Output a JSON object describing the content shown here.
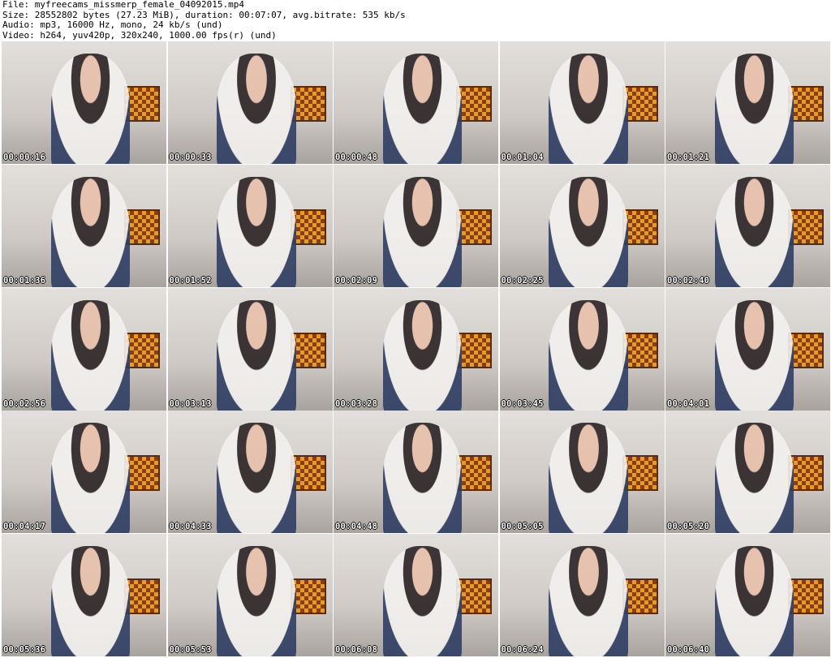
{
  "header": {
    "file_line": "File: myfreecams_missmerp_female_04092015.mp4",
    "size_line": "Size: 28552802 bytes (27.23 MiB), duration: 00:07:07, avg.bitrate: 535 kb/s",
    "audio_line": "Audio: mp3, 16000 Hz, mono, 24 kb/s (und)",
    "video_line": "Video: h264, yuv420p, 320x240, 1000.00 fps(r) (und)"
  },
  "thumbnails": [
    {
      "timestamp": "00:00:16"
    },
    {
      "timestamp": "00:00:33"
    },
    {
      "timestamp": "00:00:48"
    },
    {
      "timestamp": "00:01:04"
    },
    {
      "timestamp": "00:01:21"
    },
    {
      "timestamp": "00:01:36"
    },
    {
      "timestamp": "00:01:52"
    },
    {
      "timestamp": "00:02:09"
    },
    {
      "timestamp": "00:02:25"
    },
    {
      "timestamp": "00:02:40"
    },
    {
      "timestamp": "00:02:56"
    },
    {
      "timestamp": "00:03:13"
    },
    {
      "timestamp": "00:03:28"
    },
    {
      "timestamp": "00:03:45"
    },
    {
      "timestamp": "00:04:01"
    },
    {
      "timestamp": "00:04:17"
    },
    {
      "timestamp": "00:04:33"
    },
    {
      "timestamp": "00:04:48"
    },
    {
      "timestamp": "00:05:05"
    },
    {
      "timestamp": "00:05:20"
    },
    {
      "timestamp": "00:05:36"
    },
    {
      "timestamp": "00:05:53"
    },
    {
      "timestamp": "00:06:08"
    },
    {
      "timestamp": "00:06:24"
    },
    {
      "timestamp": "00:06:40"
    }
  ]
}
